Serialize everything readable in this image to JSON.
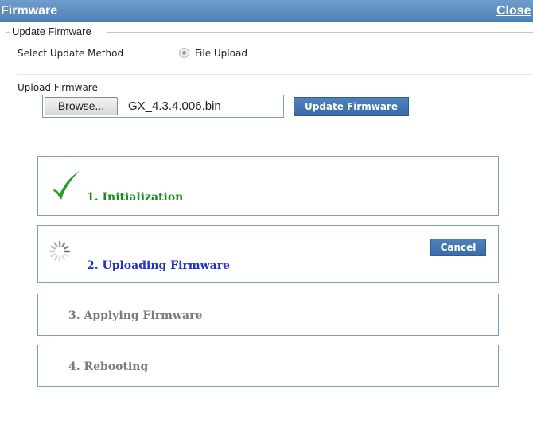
{
  "dialog": {
    "title": "Firmware",
    "close_label": "Close"
  },
  "update_section": {
    "legend": "Update Firmware",
    "method_label": "Select Update Method",
    "method_option": "File Upload",
    "method_selected": true,
    "upload_label": "Upload Firmware",
    "browse_label": "Browse...",
    "file_name": "GX_4.3.4.006.bin",
    "update_button": "Update Firmware"
  },
  "steps": [
    {
      "label": "1. Initialization",
      "status": "complete",
      "icon": "checkmark-icon",
      "color": "#1f8a1f"
    },
    {
      "label": "2. Uploading Firmware",
      "status": "in-progress",
      "icon": "spinner-icon",
      "color": "#1f2fcc",
      "action_label": "Cancel"
    },
    {
      "label": "3. Applying Firmware",
      "status": "pending",
      "color": "#7a7a7a"
    },
    {
      "label": "4. Rebooting",
      "status": "pending",
      "color": "#7a7a7a"
    }
  ],
  "colors": {
    "titlebar": "#5b8cc0",
    "button": "#3f72ae",
    "step_border": "#7a9fc6"
  }
}
